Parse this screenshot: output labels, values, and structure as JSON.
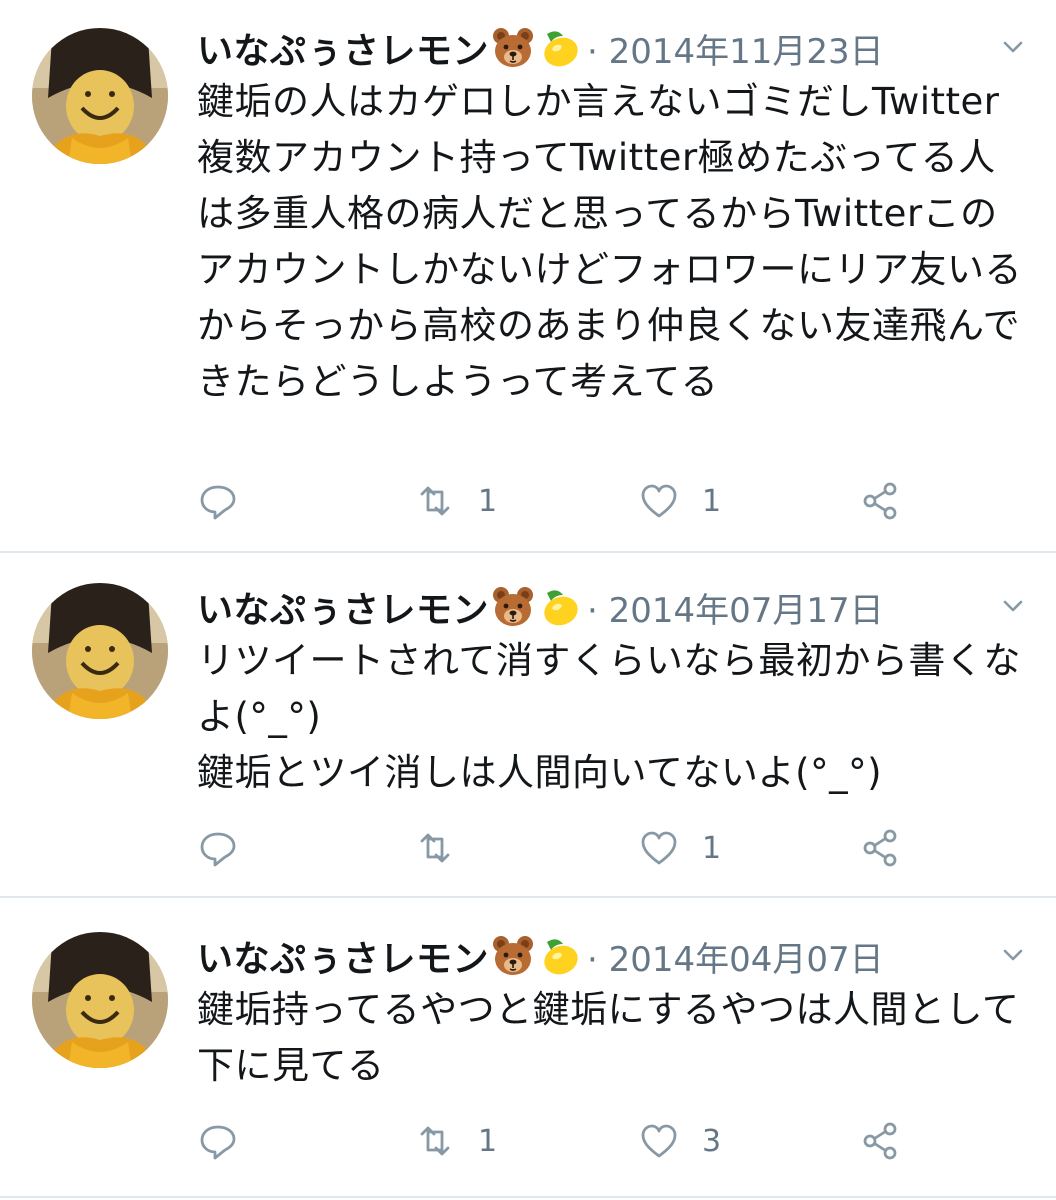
{
  "tweets": [
    {
      "user_name": "いなぷぅさレモン",
      "date": "· 2014年11月23日",
      "text": "鍵垢の人はカゲロしか言えないゴミだしTwitter複数アカウント持ってTwitter極めたぶってる人は多重人格の病人だと思ってるからTwitterこのアカウントしかないけどフォロワーにリア友いるからそっから高校のあまり仲良くない友達飛んできたらどうしようって考えてる",
      "reply_count": "",
      "retweet_count": "1",
      "like_count": "1"
    },
    {
      "user_name": "いなぷぅさレモン",
      "date": "· 2014年07月17日",
      "text": "リツイートされて消すくらいなら最初から書くなよ(°_°)\n鍵垢とツイ消しは人間向いてないよ(°_°)",
      "reply_count": "",
      "retweet_count": "",
      "like_count": "1"
    },
    {
      "user_name": "いなぷぅさレモン",
      "date": "· 2014年04月07日",
      "text": "鍵垢持ってるやつと鍵垢にするやつは人間として下に見てる",
      "reply_count": "",
      "retweet_count": "1",
      "like_count": "3"
    }
  ],
  "icons": {
    "name_emojis": [
      "bear-face-emoji",
      "lemon-emoji"
    ],
    "actions": [
      "reply-icon",
      "retweet-icon",
      "like-icon",
      "share-icon"
    ],
    "menu": "chevron-down-icon"
  },
  "colors": {
    "text": "#14171a",
    "secondary": "#657786",
    "divider": "#e1e8ed"
  }
}
